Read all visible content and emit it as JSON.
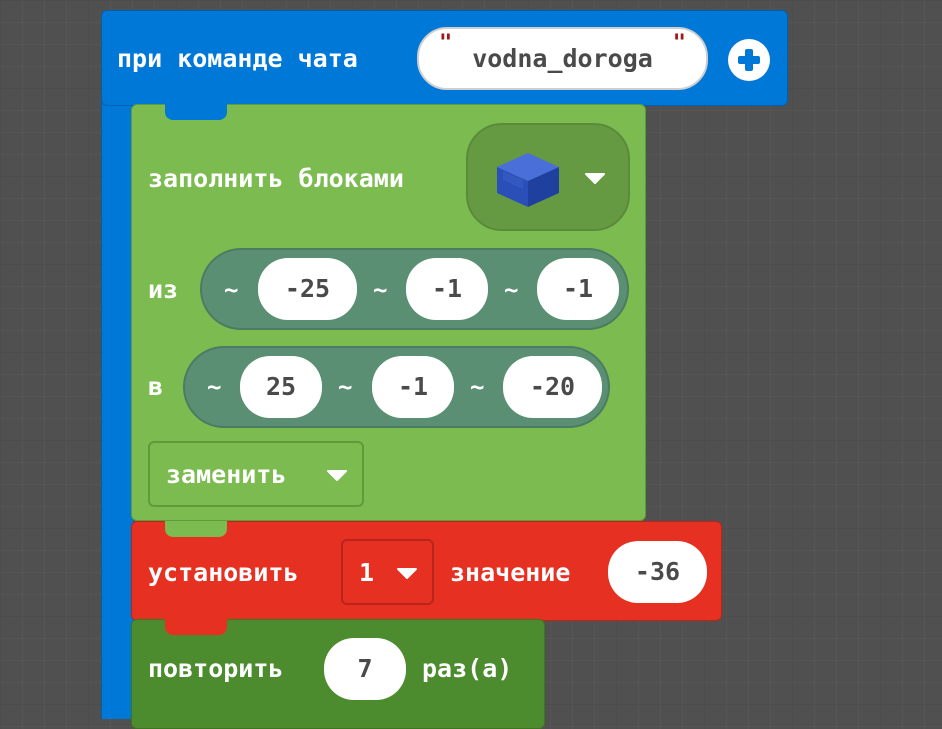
{
  "event": {
    "label": "при команде чата",
    "command_value": "vodna_doroga",
    "add_icon": "plus-circle-icon"
  },
  "fill": {
    "label": "заполнить блоками",
    "block_icon": "blue-block-icon",
    "from_label": "из",
    "from": {
      "x": "-25",
      "y": "-1",
      "z": "-1"
    },
    "to_label": "в",
    "to": {
      "x": "25",
      "y": "-1",
      "z": "-20"
    },
    "tilde": "~",
    "mode_label": "заменить"
  },
  "set": {
    "label": "установить",
    "var_value": "1",
    "value_label": "значение",
    "value": "-36"
  },
  "repeat": {
    "label": "повторить",
    "count": "7",
    "suffix": "раз(а)"
  },
  "colors": {
    "event": "#0078d7",
    "fill": "#7bbb50",
    "set": "#e63022",
    "repeat": "#4c8c2e"
  }
}
